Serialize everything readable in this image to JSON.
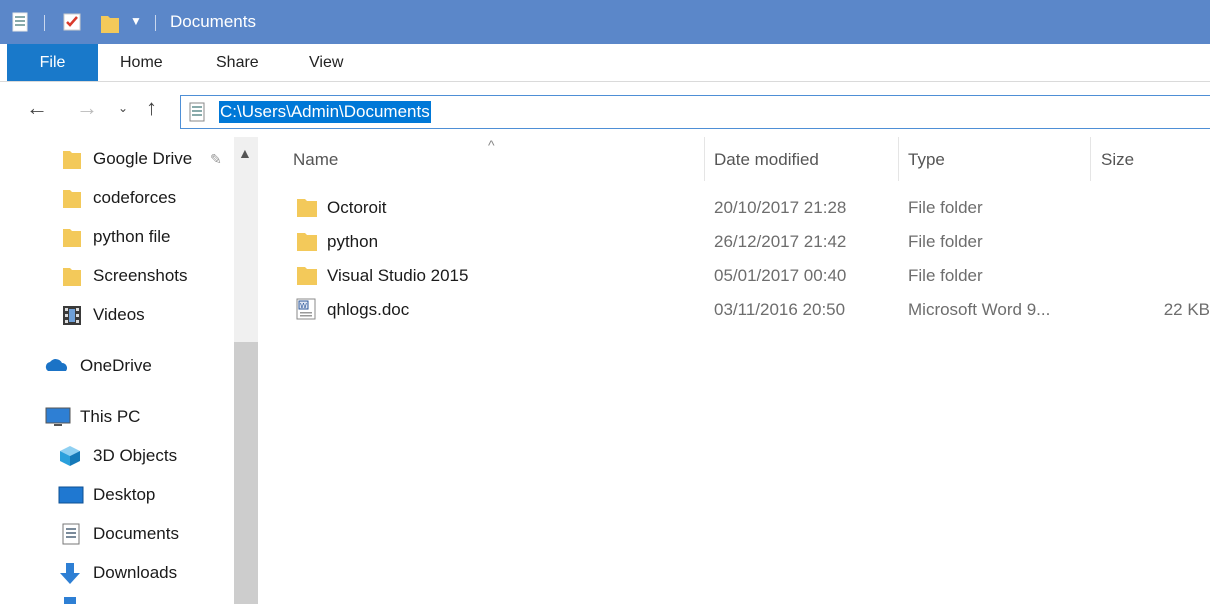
{
  "window": {
    "title": "Documents"
  },
  "ribbon": {
    "tabs": [
      "File",
      "Home",
      "Share",
      "View"
    ]
  },
  "address": {
    "path": "C:\\Users\\Admin\\Documents"
  },
  "nav_pane": {
    "items": [
      {
        "label": "Google Drive",
        "icon": "folder-icon",
        "pinned": true
      },
      {
        "label": "codeforces",
        "icon": "folder-icon"
      },
      {
        "label": "python file",
        "icon": "folder-icon"
      },
      {
        "label": "Screenshots",
        "icon": "folder-icon"
      },
      {
        "label": "Videos",
        "icon": "videos-icon"
      },
      {
        "label": "OneDrive",
        "icon": "onedrive-icon"
      },
      {
        "label": "This PC",
        "icon": "this-pc-icon"
      },
      {
        "label": "3D Objects",
        "icon": "3d-objects-icon"
      },
      {
        "label": "Desktop",
        "icon": "desktop-icon"
      },
      {
        "label": "Documents",
        "icon": "documents-icon"
      },
      {
        "label": "Downloads",
        "icon": "downloads-icon"
      }
    ]
  },
  "file_list": {
    "columns": {
      "name": "Name",
      "date": "Date modified",
      "type": "Type",
      "size": "Size"
    },
    "rows": [
      {
        "name": "Octoroit",
        "date": "20/10/2017 21:28",
        "type": "File folder",
        "size": "",
        "icon": "folder-icon"
      },
      {
        "name": "python",
        "date": "26/12/2017 21:42",
        "type": "File folder",
        "size": "",
        "icon": "folder-icon"
      },
      {
        "name": "Visual Studio 2015",
        "date": "05/01/2017 00:40",
        "type": "File folder",
        "size": "",
        "icon": "folder-icon"
      },
      {
        "name": "qhlogs.doc",
        "date": "03/11/2016 20:50",
        "type": "Microsoft Word 9...",
        "size": "22 KB",
        "icon": "word-doc-icon"
      }
    ]
  },
  "colors": {
    "titlebar": "#5b87c9",
    "file_tab": "#1979ca",
    "selection": "#0078d7",
    "folder": "#f3c95a"
  }
}
